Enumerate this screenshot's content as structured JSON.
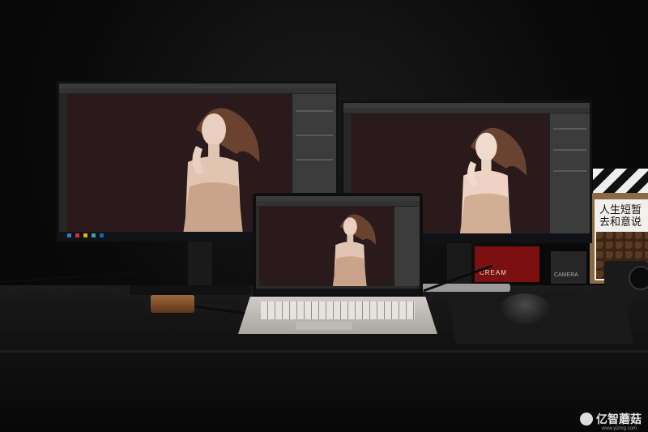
{
  "scene": {
    "description_type": "photo-of-workstation",
    "colors": {
      "canvas_background": "#2a1a1c",
      "photoshop_ui": "#3c3c3c",
      "brand_red": "#7a1010"
    }
  },
  "props": {
    "calligraphy_lines": [
      "人生短暂",
      "去和意说"
    ],
    "camera_box_label": "CAMERA",
    "red_box_label": "CREAM"
  },
  "watermark": {
    "brand": "亿智蘑菇",
    "url": "www.yizmg.com"
  }
}
